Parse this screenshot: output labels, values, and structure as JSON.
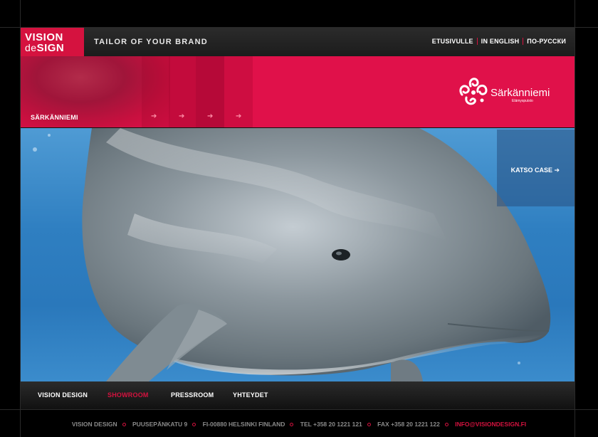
{
  "header": {
    "logo_line1": "VISION",
    "logo_line2_small": "de",
    "logo_line2": "SIGN",
    "tagline": "TAILOR OF YOUR BRAND",
    "langs": [
      "ETUSIVULLE",
      "IN ENGLISH",
      "ПО-РУССКИ"
    ]
  },
  "banner": {
    "title": "SÄRKÄNNIEMI",
    "arrow": "➔",
    "client_name": "Särkänniemi",
    "client_sub": "Elämyspuisto"
  },
  "showcase": {
    "case_link": "KATSO CASE ➔",
    "subject": "dolphin-photo"
  },
  "nav": {
    "items": [
      "VISION DESIGN",
      "SHOWROOM",
      "PRESSROOM",
      "YHTEYDET"
    ],
    "active": "SHOWROOM"
  },
  "address": {
    "company": "VISION DESIGN",
    "street": "PUUSEPÄNKATU  9",
    "city": "FI-00880 HELSINKI FINLAND",
    "tel": "TEL +358 20 1221 121",
    "fax": "FAX +358 20 1221 122",
    "email": "INFO@VISIONDESIGN.FI"
  },
  "colors": {
    "accent": "#d5123f",
    "banner": "#e0114a",
    "water": "#2f7fc1"
  }
}
